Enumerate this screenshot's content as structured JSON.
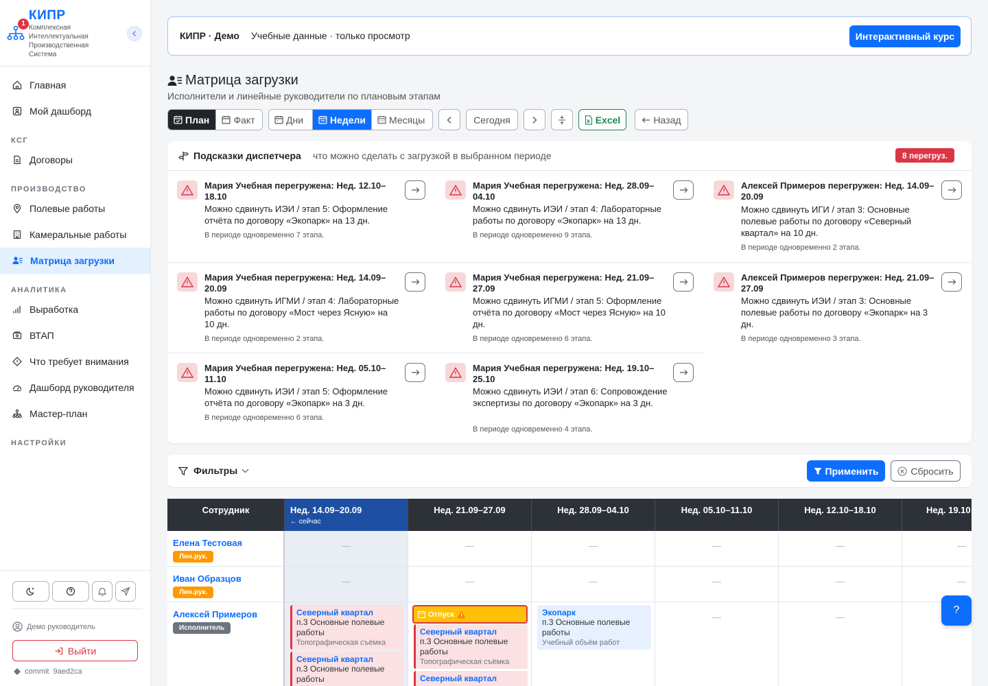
{
  "brand": {
    "title": "КИПР",
    "subtitle": "Комплексная Интеллектуальная Производственная Система",
    "badge": "1"
  },
  "nav": {
    "home": "Главная",
    "my_dashboard": "Мой дашборд",
    "section_ksg": "КСГ",
    "contracts": "Договоры",
    "section_production": "ПРОИЗВОДСТВО",
    "field_works": "Полевые работы",
    "office_works": "Камеральные работы",
    "load_matrix": "Матрица загрузки",
    "section_analytics": "АНАЛИТИКА",
    "output": "Выработка",
    "vtap": "ВТАП",
    "attention": "Что требует внимания",
    "manager_dashboard": "Дашборд руководителя",
    "master_plan": "Мастер-план",
    "section_settings": "НАСТРОЙКИ"
  },
  "sidebar_footer": {
    "user": "Демо руководитель",
    "logout": "Выйти",
    "commit_label": "commit",
    "commit_hash": "9aed2ca"
  },
  "banner": {
    "title": "КИПР · Демо",
    "text": "Учебные данные · только просмотр",
    "course_button": "Интерактивный курс"
  },
  "page": {
    "title": "Матрица загрузки",
    "subtitle": "Исполнители и линейные руководители по плановым этапам"
  },
  "toolbar": {
    "plan": "План",
    "fact": "Факт",
    "days": "Дни",
    "weeks": "Недели",
    "months": "Месяцы",
    "today": "Сегодня",
    "excel": "Excel",
    "back": "Назад"
  },
  "hints": {
    "title": "Подсказки диспетчера",
    "subtitle": "что можно сделать с загрузкой в выбранном периоде",
    "overload_badge": "8 перегруз.",
    "items": [
      {
        "title": "Мария Учебная перегружена: Нед. 12.10–18.10",
        "desc": "Можно сдвинуть ИЭИ / этап 5: Оформление отчёта по договору «Экопарк» на 13 дн.",
        "note": "В периоде одновременно 7 этапа."
      },
      {
        "title": "Мария Учебная перегружена: Нед. 28.09–04.10",
        "desc": "Можно сдвинуть ИЭИ / этап 4: Лабораторные работы по договору «Экопарк» на 13 дн.",
        "note": "В периоде одновременно 9 этапа."
      },
      {
        "title": "Алексей Примеров перегружен: Нед. 14.09–20.09",
        "desc": "Можно сдвинуть ИГИ / этап 3: Основные полевые работы по договору «Северный квартал» на 10 дн.",
        "note": "В периоде одновременно 2 этапа."
      },
      {
        "title": "Мария Учебная перегружена: Нед. 14.09–20.09",
        "desc": "Можно сдвинуть ИГМИ / этап 4: Лабораторные работы по договору «Мост через Ясную» на 10 дн.",
        "note": "В периоде одновременно 2 этапа."
      },
      {
        "title": "Мария Учебная перегружена: Нед. 21.09–27.09",
        "desc": "Можно сдвинуть ИГМИ / этап 5: Оформление отчёта по договору «Мост через Ясную» на 10 дн.",
        "note": "В периоде одновременно 6 этапа."
      },
      {
        "title": "Алексей Примеров перегружен: Нед. 21.09–27.09",
        "desc": "Можно сдвинуть ИЭИ / этап 3: Основные полевые работы по договору «Экопарк» на 3 дн.",
        "note": "В периоде одновременно 3 этапа."
      },
      {
        "title": "Мария Учебная перегружена: Нед. 05.10–11.10",
        "desc": "Можно сдвинуть ИЭИ / этап 5: Оформление отчёта по договору «Экопарк» на 3 дн.",
        "note": "В периоде одновременно 6 этапа."
      },
      {
        "title": "Мария Учебная перегружена: Нед. 19.10–25.10",
        "desc": "Можно сдвинуть ИЭИ / этап 6: Сопровождение экспертизы по договору «Экопарк» на 3 дн.",
        "note": "В периоде одновременно 4 этапа."
      }
    ]
  },
  "filters": {
    "label": "Фильтры",
    "apply": "Применить",
    "reset": "Сбросить"
  },
  "grid": {
    "employee_header": "Сотрудник",
    "weeks": [
      "Нед. 14.09–20.09",
      "Нед. 21.09–27.09",
      "Нед. 28.09–04.10",
      "Нед. 05.10–11.10",
      "Нед. 12.10–18.10",
      "Нед. 19.10"
    ],
    "now_label": "← сейчас",
    "empty": "—",
    "employees": [
      {
        "name": "Елена Тестовая",
        "role": "Лин.рук."
      },
      {
        "name": "Иван Образцов",
        "role": "Лин.рук."
      },
      {
        "name": "Алексей Примеров",
        "role": "Исполнитель"
      }
    ],
    "vacation": "Отпуск",
    "tasks": {
      "w1_a": {
        "project": "Северный квартал",
        "stage": "п.3 Основные полевые работы",
        "note": "Топографическая съёмка"
      },
      "w1_b": {
        "project": "Северный квартал",
        "stage": "п.3 Основные полевые работы"
      },
      "w2_a": {
        "project": "Северный квартал",
        "stage": "п.3 Основные полевые работы",
        "note": "Топографическая съёмка"
      },
      "w2_b": {
        "project": "Северный квартал"
      },
      "w3_a": {
        "project": "Экопарк",
        "stage": "п.3 Основные полевые работы",
        "note": "Учебный объём работ"
      }
    }
  },
  "help": "?"
}
